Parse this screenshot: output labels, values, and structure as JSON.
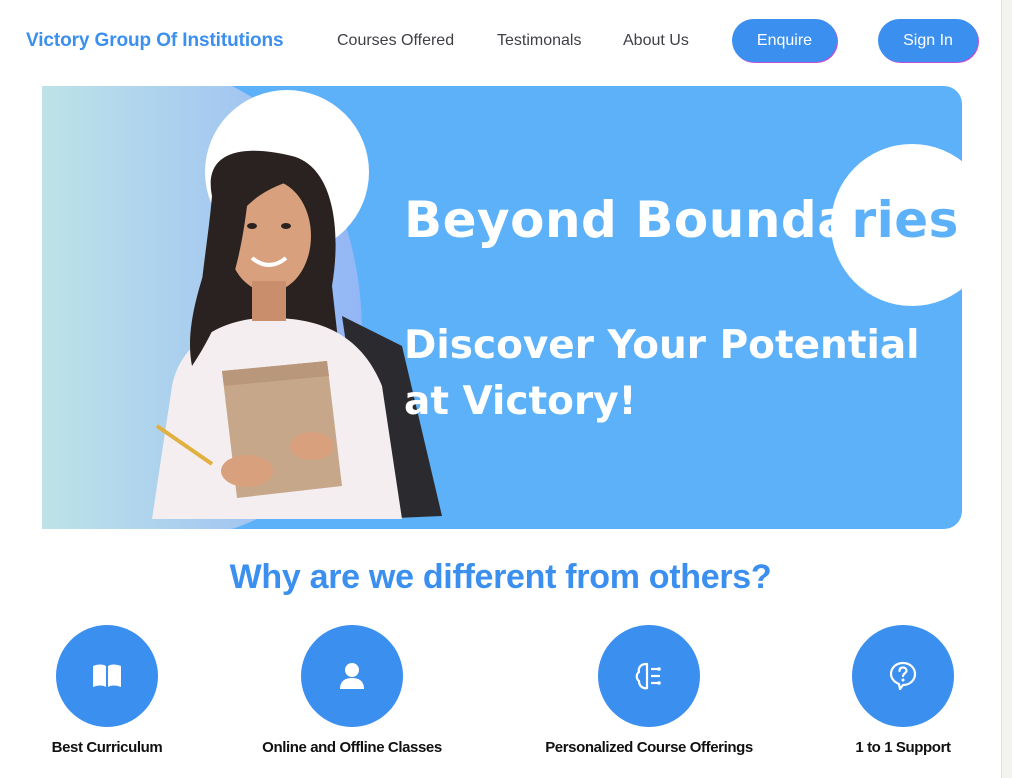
{
  "nav": {
    "brand": "Victory Group Of Institutions",
    "links": [
      "Courses Offered",
      "Testimonals",
      "About Us"
    ],
    "enquire_label": "Enquire",
    "signin_label": "Sign In"
  },
  "hero": {
    "title_main": "Beyond Bounda",
    "title_tail": "ries",
    "subtitle": "Discover Your Potential at Victory!",
    "image": "student-holding-notebook-photo"
  },
  "section": {
    "title": "Why are we different from others?"
  },
  "features": [
    {
      "label": "Best Curriculum",
      "icon": "book-icon"
    },
    {
      "label": "Online and Offline Classes",
      "icon": "user-icon"
    },
    {
      "label": "Personalized Course Offerings",
      "icon": "brain-icon"
    },
    {
      "label": "1 to 1 Support",
      "icon": "question-bubble-icon"
    }
  ],
  "colors": {
    "accent": "#3b8fee",
    "hero_bg": "#5db1f9",
    "button_shadow": "#c04fd6"
  }
}
